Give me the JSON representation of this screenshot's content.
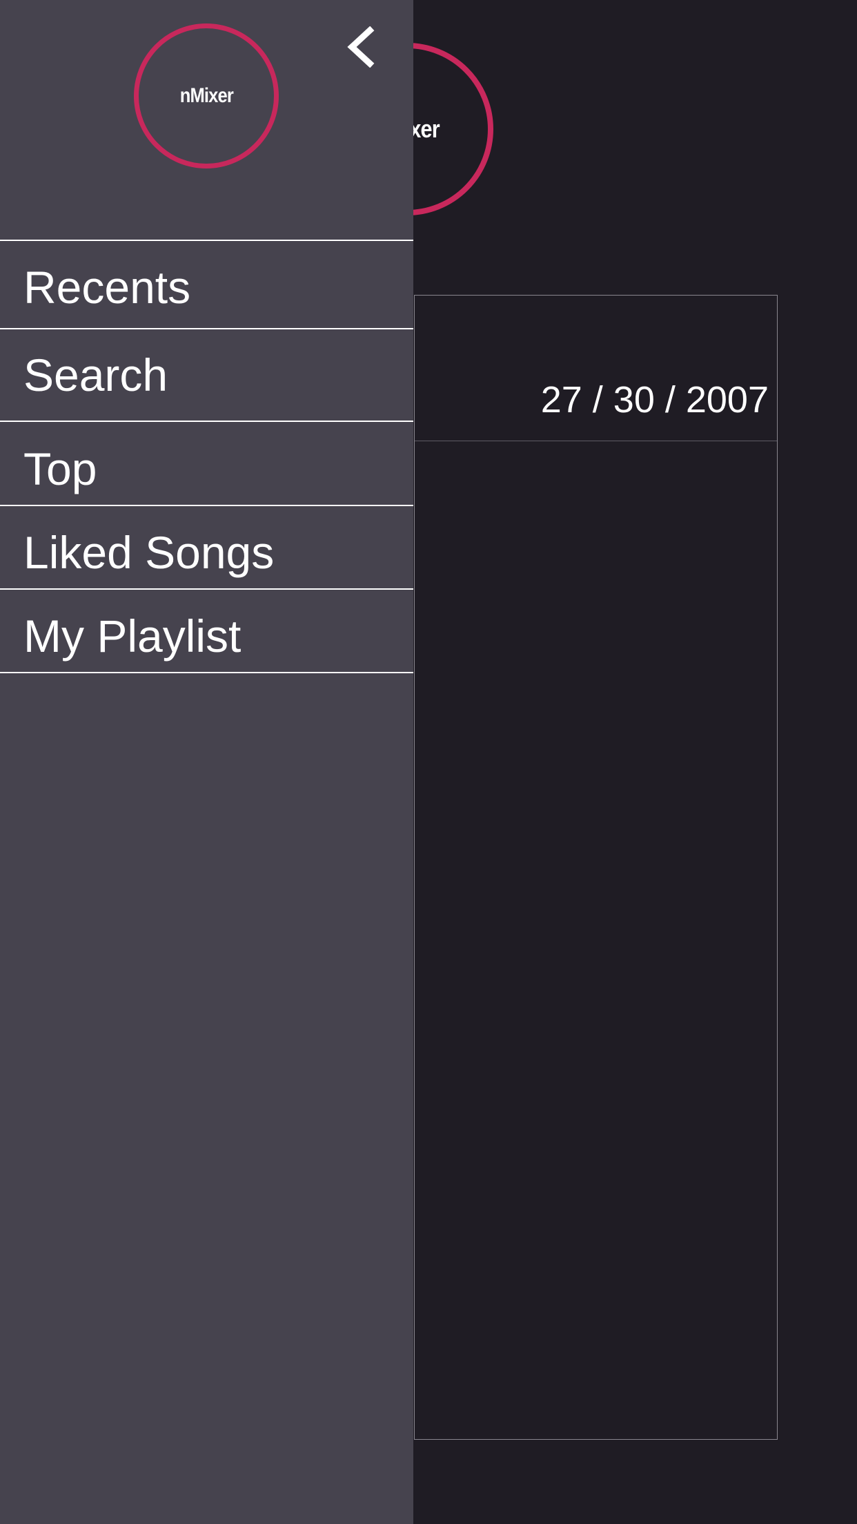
{
  "main": {
    "logo_text": "nMixer",
    "date": "27 / 30 / 2007"
  },
  "drawer": {
    "logo_text": "nMixer",
    "back_icon": "chevron-left-icon",
    "items": [
      {
        "label": "Recents"
      },
      {
        "label": "Search"
      },
      {
        "label": "Top"
      },
      {
        "label": "Liked Songs"
      },
      {
        "label": "My Playlist"
      }
    ]
  },
  "colors": {
    "background": "#1f1c24",
    "drawer": "#46434e",
    "accent": "#c8285c",
    "text": "#ffffff"
  }
}
